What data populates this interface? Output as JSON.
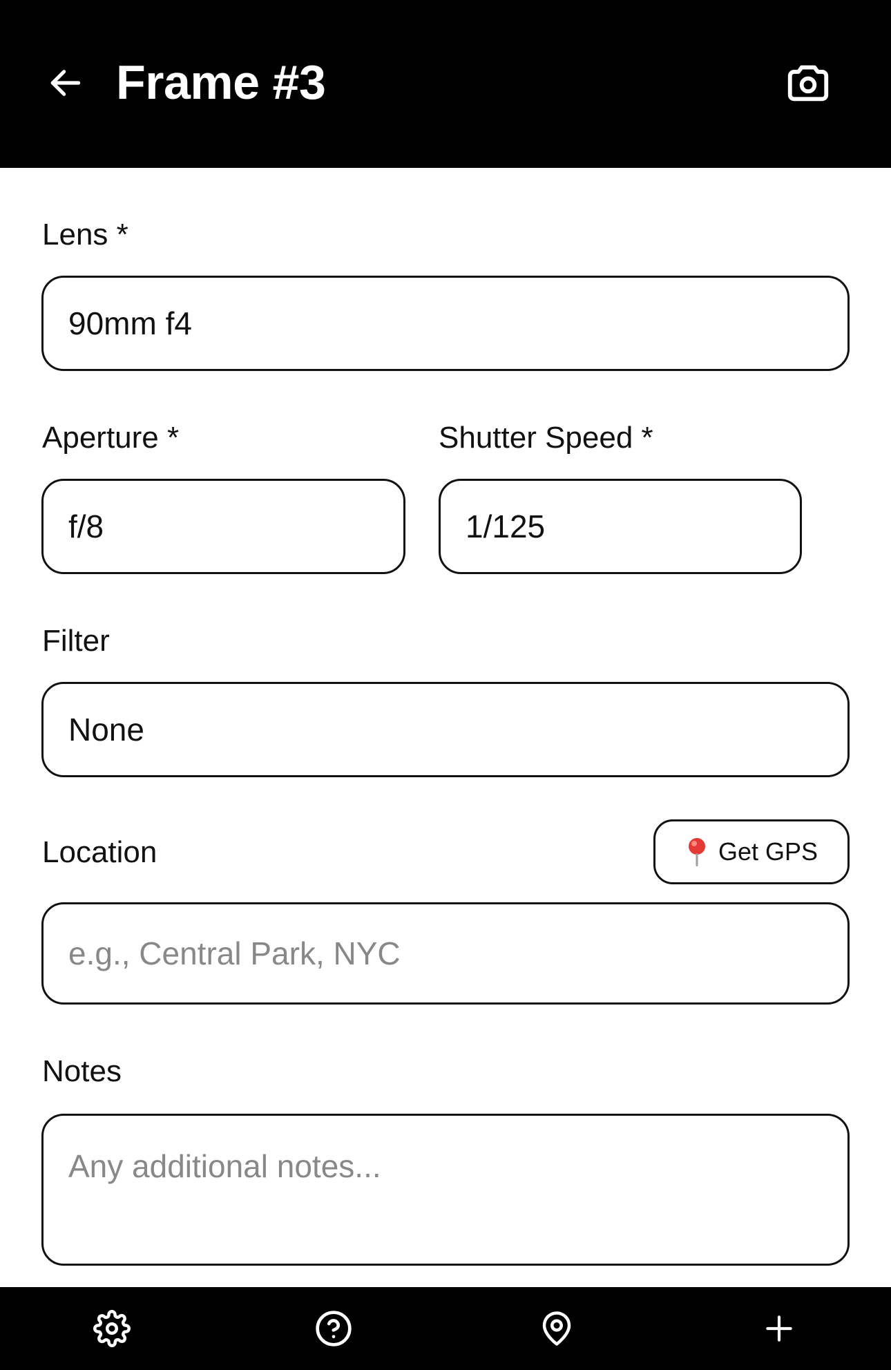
{
  "header": {
    "title": "Frame #3",
    "back_icon": "arrow-left-icon",
    "camera_icon": "camera-icon"
  },
  "form": {
    "lens": {
      "label": "Lens *",
      "value": "90mm f4"
    },
    "aperture": {
      "label": "Aperture *",
      "value": "f/8"
    },
    "shutter_speed": {
      "label": "Shutter Speed *",
      "value": "1/125"
    },
    "filter": {
      "label": "Filter",
      "value": "None"
    },
    "location": {
      "label": "Location",
      "value": "",
      "placeholder": "e.g., Central Park, NYC",
      "gps_button": {
        "icon": "pushpin-icon",
        "label": "Get GPS"
      }
    },
    "notes": {
      "label": "Notes",
      "value": "",
      "placeholder": "Any additional notes..."
    }
  },
  "bottom_nav": {
    "items": [
      {
        "icon": "gear-icon"
      },
      {
        "icon": "help-circle-icon"
      },
      {
        "icon": "map-pin-icon"
      },
      {
        "icon": "plus-icon"
      }
    ]
  },
  "colors": {
    "bar_background": "#000000",
    "page_background": "#ffffff",
    "border": "#111111",
    "placeholder": "#888888",
    "pin_head": "#e53935"
  }
}
